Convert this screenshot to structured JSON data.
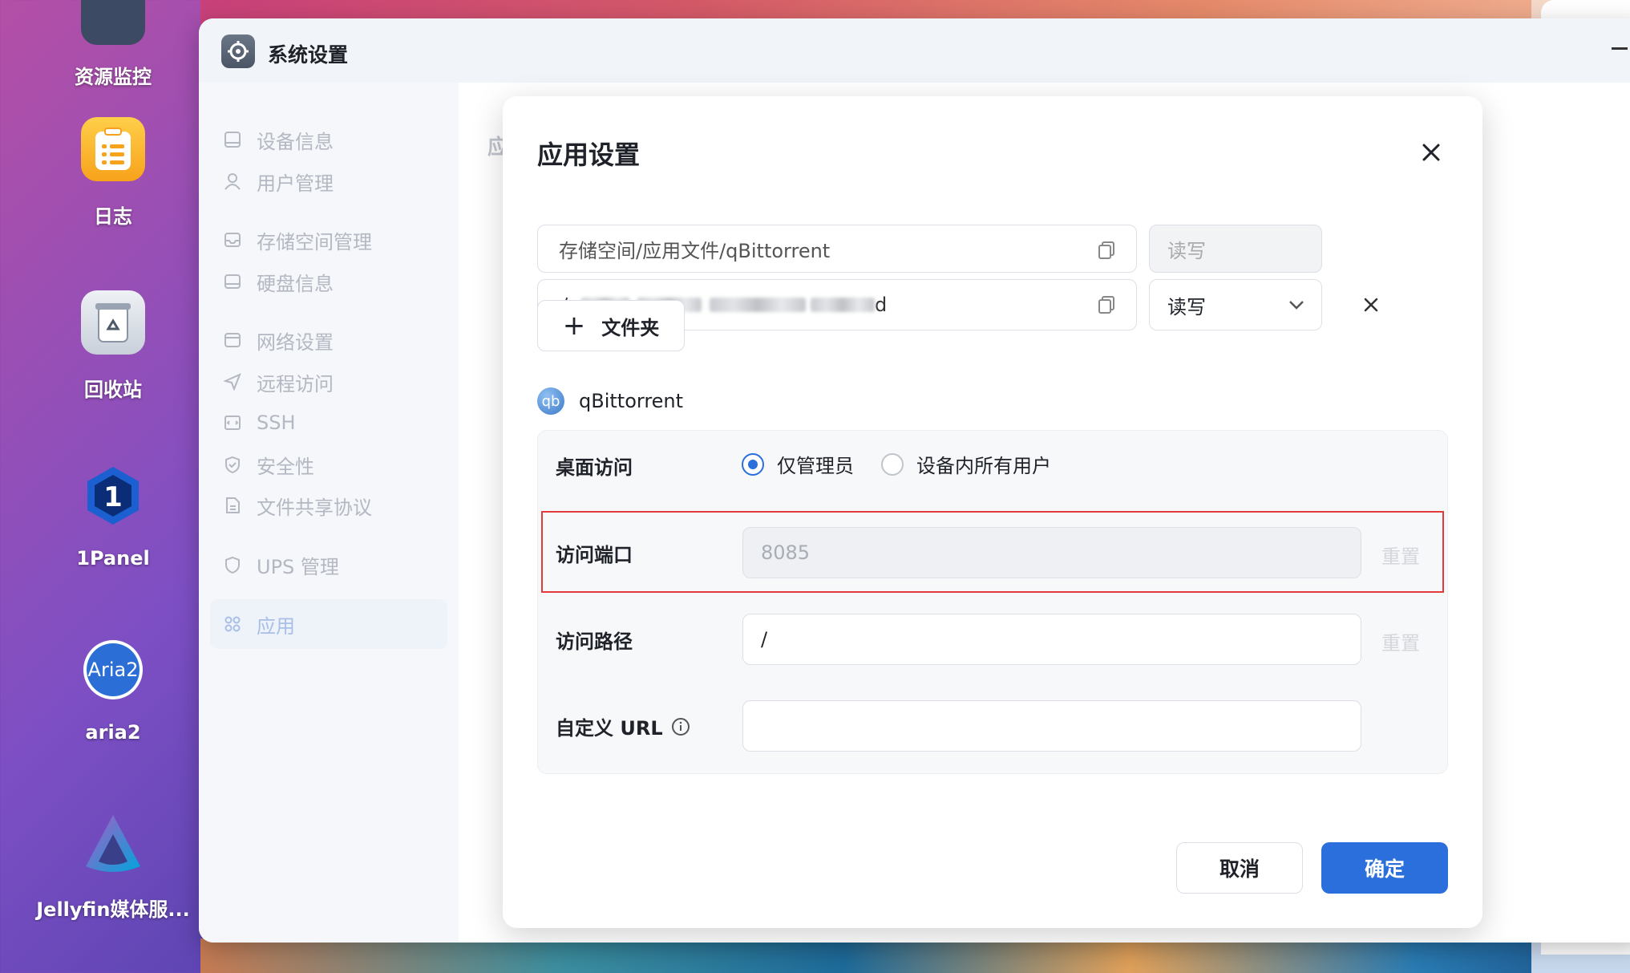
{
  "desktop": {
    "icons": [
      {
        "label": "资源监控",
        "icon": "monitor-icon"
      },
      {
        "label": "日志",
        "icon": "log-icon"
      },
      {
        "label": "回收站",
        "icon": "recycle-bin-icon"
      },
      {
        "label": "1Panel",
        "icon": "1panel-icon"
      },
      {
        "label": "aria2",
        "icon": "aria2-icon"
      },
      {
        "label": "Jellyfin媒体服...",
        "icon": "jellyfin-icon"
      }
    ]
  },
  "window": {
    "title": "系统设置",
    "content_peek": "应"
  },
  "sidebar": {
    "items": [
      {
        "label": "设备信息",
        "icon": "device-icon"
      },
      {
        "label": "用户管理",
        "icon": "user-icon"
      },
      {
        "label": "存储空间管理",
        "icon": "storage-icon"
      },
      {
        "label": "硬盘信息",
        "icon": "disk-icon"
      },
      {
        "label": "网络设置",
        "icon": "network-icon"
      },
      {
        "label": "远程访问",
        "icon": "remote-icon"
      },
      {
        "label": "SSH",
        "icon": "ssh-icon"
      },
      {
        "label": "安全性",
        "icon": "shield-icon"
      },
      {
        "label": "文件共享协议",
        "icon": "file-share-icon"
      },
      {
        "label": "UPS 管理",
        "icon": "ups-icon"
      },
      {
        "label": "应用",
        "icon": "apps-icon",
        "active": true
      }
    ]
  },
  "dialog": {
    "title": "应用设置",
    "folders": [
      {
        "path_visible_start": "存储空间/应用文件/qBittorrent",
        "permission": "读写"
      },
      {
        "path_visible_start": "存",
        "path_visible_end": "d",
        "permission": "读写"
      }
    ],
    "add_folder_label": "文件夹",
    "app": {
      "name": "qBittorrent",
      "logo_text": "qb"
    },
    "desktop_access": {
      "label": "桌面访问",
      "options": [
        "仅管理员",
        "设备内所有用户"
      ],
      "selected": "仅管理员"
    },
    "port": {
      "label": "访问端口",
      "value": "8085",
      "reset_label": "重置"
    },
    "path": {
      "label": "访问路径",
      "value": "/",
      "reset_label": "重置"
    },
    "custom_url": {
      "label": "自定义 URL",
      "value": ""
    },
    "cancel_label": "取消",
    "ok_label": "确定"
  },
  "colors": {
    "primary": "#2a6fdb",
    "highlight": "#e33b3b"
  }
}
